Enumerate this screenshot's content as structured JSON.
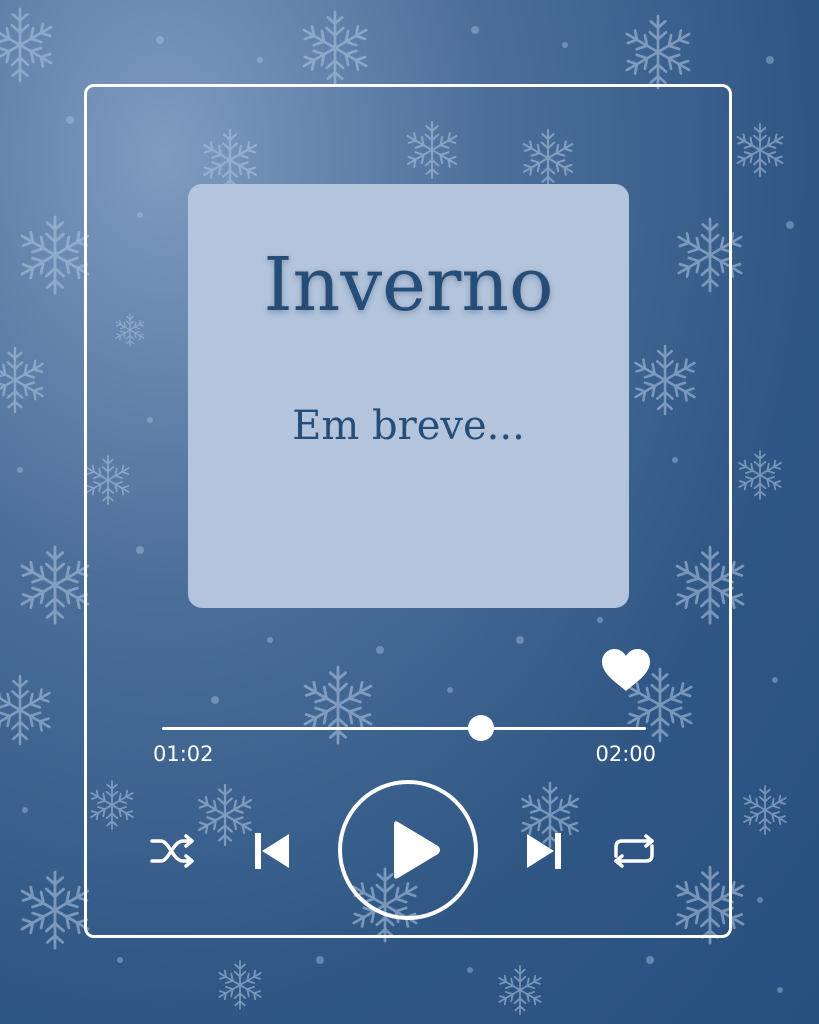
{
  "player": {
    "title": "Inverno",
    "subtitle": "Em breve...",
    "time_elapsed": "01:02",
    "time_total": "02:00",
    "progress": 0.66,
    "liked": true
  },
  "icons": {
    "shuffle": "shuffle-icon",
    "previous": "skip-previous-icon",
    "play": "play-icon",
    "next": "skip-next-icon",
    "repeat": "repeat-icon",
    "like": "heart-icon"
  },
  "colors": {
    "background": "#2f5684",
    "cover": "#b3c4dc",
    "text": "#264d78",
    "controls": "#ffffff",
    "snowflake": "#a9c1de"
  }
}
